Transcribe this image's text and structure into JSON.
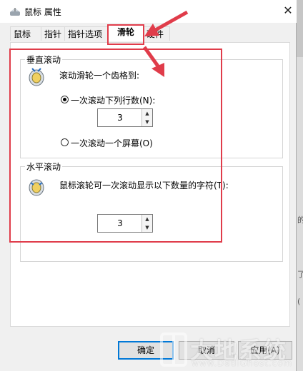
{
  "window": {
    "title": "鼠标 属性",
    "close_glyph": "✕"
  },
  "tabs": [
    "鼠标键",
    "指针",
    "指针选项",
    "滑轮",
    "硬件"
  ],
  "vertical": {
    "title": "垂直滚动",
    "prompt": "滚动滑轮一个齿格到:",
    "option_lines": "一次滚动下列行数(N):",
    "lines_value": "3",
    "option_screen": "一次滚动一个屏幕(O)"
  },
  "horizontal": {
    "title": "水平滚动",
    "prompt": "鼠标滚轮可一次滚动显示以下数量的字符(T):",
    "chars_value": "3"
  },
  "buttons": {
    "ok": "确定",
    "cancel": "取消",
    "apply": "应用(A)"
  },
  "watermark": {
    "big": "大地系统",
    "small": "www.DadiGhost.com"
  },
  "edge_fragments": [
    "的",
    "了",
    "(",
    "e",
    "i"
  ]
}
